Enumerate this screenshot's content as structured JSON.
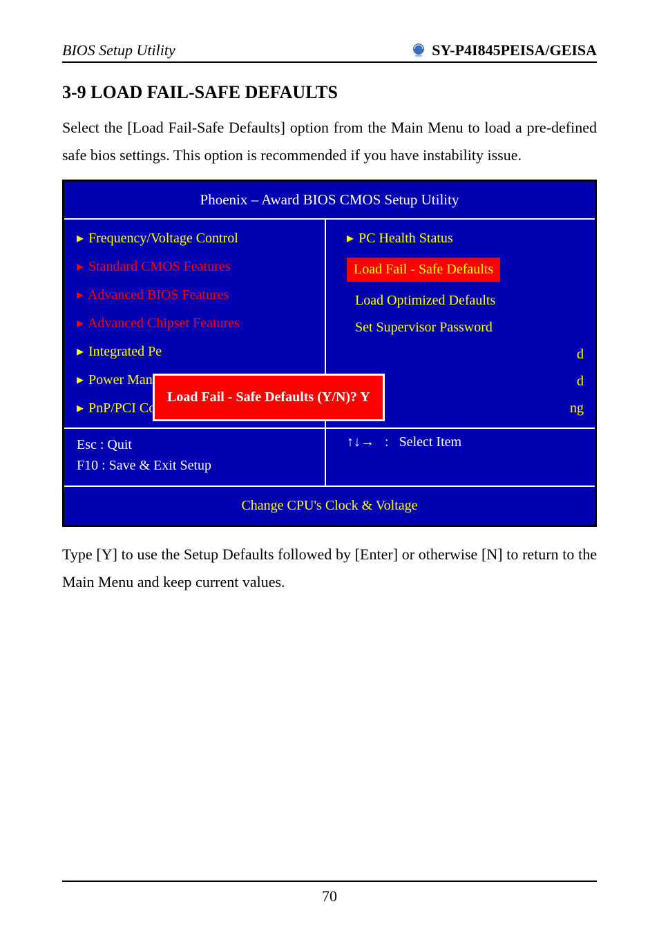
{
  "header": {
    "left": "BIOS Setup Utility",
    "right": "SY-P4I845PEISA/GEISA"
  },
  "section_title": "3-9  LOAD FAIL-SAFE DEFAULTS",
  "intro_text": "Select the [Load Fail-Safe Defaults] option from the Main Menu to load a pre-defined safe bios settings. This option is recommended if you have instability issue.",
  "bios": {
    "title": "Phoenix – Award BIOS CMOS Setup Utility",
    "left_items": [
      "Frequency/Voltage Control",
      "Standard CMOS Features",
      "Advanced BIOS Features",
      "Advanced Chipset Features",
      "Integrated Pe",
      "Power Mana",
      "PnP/PCI Cor"
    ],
    "right_first": "PC Health Status",
    "right_highlight": "Load Fail - Safe Defaults",
    "right_items": [
      "Load Optimized Defaults",
      "Set Supervisor Password"
    ],
    "right_partial_1": "d",
    "right_partial_2": "d",
    "right_partial_3": "ng",
    "footer_left_1": "Esc : Quit",
    "footer_left_2": "F10 : Save & Exit Setup",
    "footer_right_arrows": "↑↓→",
    "footer_right_label": "Select Item",
    "bottom": "Change CPU's Clock & Voltage",
    "dialog": "Load Fail - Safe Defaults (Y/N)? Y"
  },
  "outro_text": "Type [Y] to use the Setup Defaults followed by [Enter] or otherwise [N] to return to the Main Menu and keep current values.",
  "page_number": "70"
}
